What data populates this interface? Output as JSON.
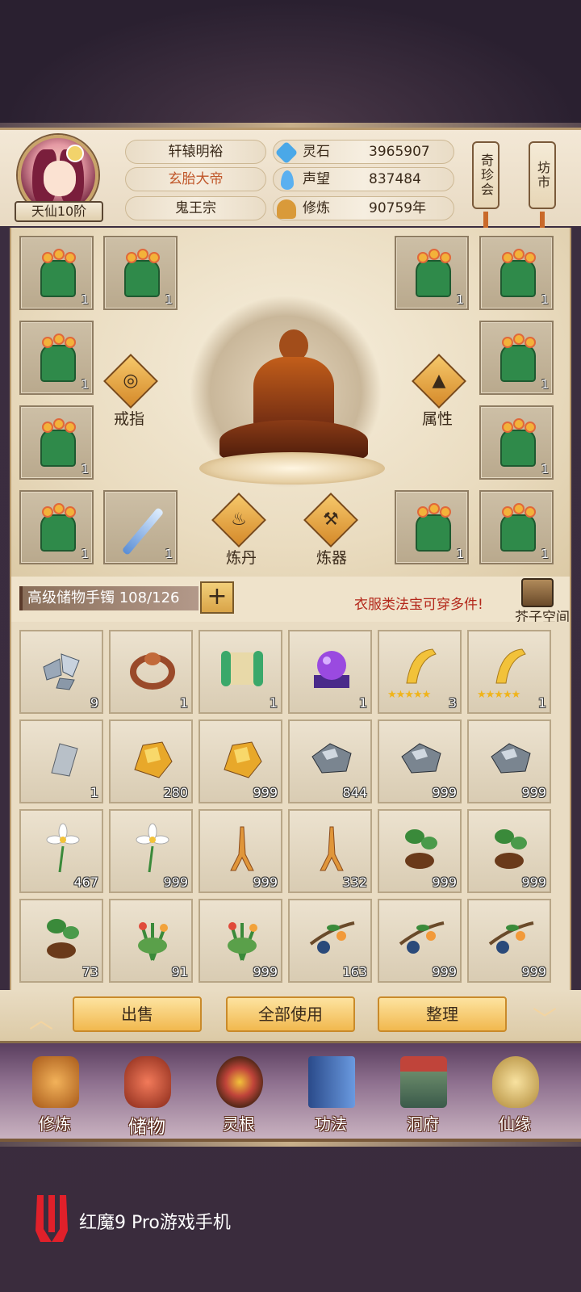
{
  "player": {
    "name": "轩辕明裕",
    "title": "玄胎大帝",
    "sect": "鬼王宗",
    "rank": "天仙10阶"
  },
  "stats": [
    {
      "label": "灵石",
      "value": "3965907",
      "icon": "spirit-stone-icon",
      "color": "#4aa8e8"
    },
    {
      "label": "声望",
      "value": "837484",
      "icon": "prestige-crystal-icon",
      "color": "#5ab0f0"
    },
    {
      "label": "修炼",
      "value": "90759年",
      "icon": "meditation-icon",
      "color": "#d99a3a"
    }
  ],
  "side_tags": {
    "treasure_auction": "奇珍会",
    "market": "坊市"
  },
  "equipment": {
    "left_slots": [
      {
        "item": "robe",
        "count": "1"
      },
      {
        "item": "robe",
        "count": "1"
      },
      {
        "item": "robe",
        "count": "1"
      },
      {
        "item": "robe",
        "count": "1"
      },
      {
        "item": "robe",
        "count": "1"
      },
      {
        "item": "sword",
        "count": "1"
      }
    ],
    "right_slots": [
      {
        "item": "robe",
        "count": "1"
      },
      {
        "item": "robe",
        "count": "1"
      },
      {
        "item": "robe",
        "count": "1"
      },
      {
        "item": "robe",
        "count": "1"
      },
      {
        "item": "robe",
        "count": "1"
      },
      {
        "item": "robe",
        "count": "1"
      }
    ],
    "ring_label": "戒指",
    "attr_label": "属性",
    "alchemy_label": "炼丹",
    "forge_label": "炼器"
  },
  "bag": {
    "label": "高级储物手镯",
    "capacity": "108/126",
    "plus": "+",
    "hint": "衣服类法宝可穿多件!",
    "space_label": "芥子空间"
  },
  "inventory": [
    [
      {
        "icon": "ore-shards-icon",
        "count": "9"
      },
      {
        "icon": "ring-icon",
        "count": "1"
      },
      {
        "icon": "scroll-icon",
        "count": "1"
      },
      {
        "icon": "purple-orb-icon",
        "count": "1"
      },
      {
        "icon": "golden-edict-icon",
        "count": "3",
        "stars": "★★★★★"
      },
      {
        "icon": "golden-edict-icon",
        "count": "1",
        "stars": "★★★★★"
      }
    ],
    [
      {
        "icon": "silver-stone-icon",
        "count": "1"
      },
      {
        "icon": "gold-ore-icon",
        "count": "280"
      },
      {
        "icon": "gold-ore-icon",
        "count": "999"
      },
      {
        "icon": "iron-ore-icon",
        "count": "844"
      },
      {
        "icon": "iron-ore-icon",
        "count": "999"
      },
      {
        "icon": "iron-ore-icon",
        "count": "999"
      }
    ],
    [
      {
        "icon": "white-flower-icon",
        "count": "467"
      },
      {
        "icon": "white-flower-icon",
        "count": "999"
      },
      {
        "icon": "ginseng-icon",
        "count": "999"
      },
      {
        "icon": "ginseng-icon",
        "count": "332"
      },
      {
        "icon": "herb-root-icon",
        "count": "999"
      },
      {
        "icon": "herb-root-icon",
        "count": "999"
      }
    ],
    [
      {
        "icon": "herb-root-icon",
        "count": "73"
      },
      {
        "icon": "grass-herb-icon",
        "count": "91"
      },
      {
        "icon": "grass-herb-icon",
        "count": "999"
      },
      {
        "icon": "fruit-branch-icon",
        "count": "163"
      },
      {
        "icon": "fruit-branch-icon",
        "count": "999"
      },
      {
        "icon": "fruit-branch-icon",
        "count": "999"
      }
    ]
  ],
  "actions": {
    "sell": "出售",
    "use_all": "全部使用",
    "sort": "整理"
  },
  "nav": [
    {
      "label": "修炼",
      "icon": "cultivate-icon",
      "color": "#d08a3a"
    },
    {
      "label": "储物",
      "icon": "storage-bag-icon",
      "color": "#c0443a"
    },
    {
      "label": "灵根",
      "icon": "spirit-root-icon",
      "color": "#8a3a2a"
    },
    {
      "label": "功法",
      "icon": "technique-book-icon",
      "color": "#3a6ab0"
    },
    {
      "label": "洞府",
      "icon": "cave-dwelling-icon",
      "color": "#6a8a6a"
    },
    {
      "label": "仙缘",
      "icon": "immortal-fate-icon",
      "color": "#b08a3a"
    }
  ],
  "device": {
    "watermark": "红魔9 Pro游戏手机"
  }
}
